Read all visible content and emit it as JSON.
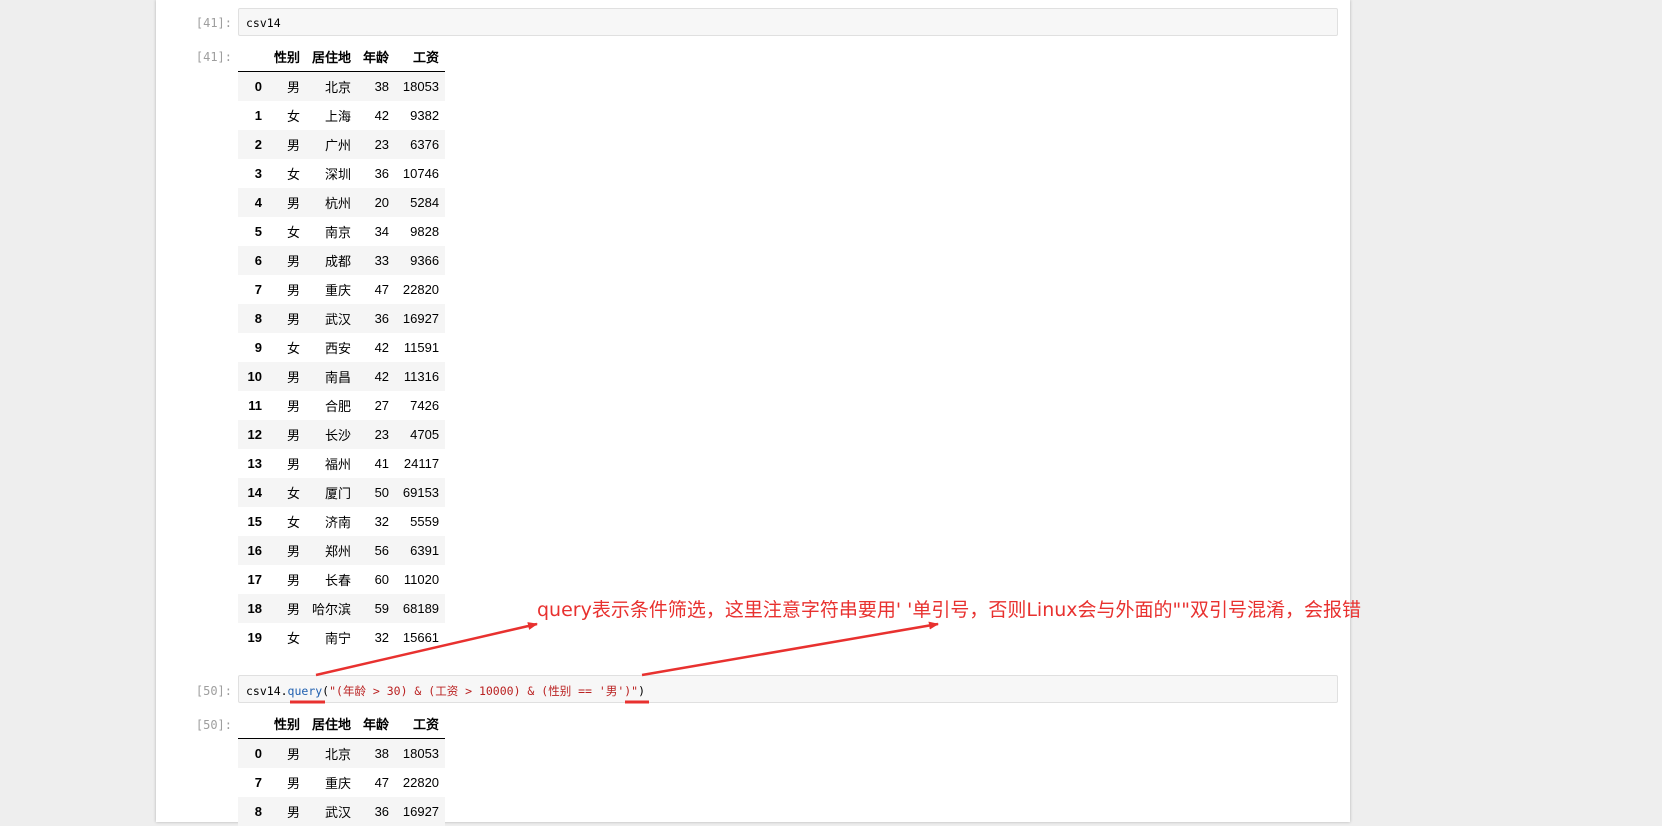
{
  "cells": [
    {
      "prompt_in": "[41]:",
      "code": "csv14",
      "prompt_out": "[41]:",
      "table": {
        "columns": [
          "性别",
          "居住地",
          "年龄",
          "工资"
        ],
        "rows": [
          {
            "index": "0",
            "性别": "男",
            "居住地": "北京",
            "年龄": "38",
            "工资": "18053"
          },
          {
            "index": "1",
            "性别": "女",
            "居住地": "上海",
            "年龄": "42",
            "工资": "9382"
          },
          {
            "index": "2",
            "性别": "男",
            "居住地": "广州",
            "年龄": "23",
            "工资": "6376"
          },
          {
            "index": "3",
            "性别": "女",
            "居住地": "深圳",
            "年龄": "36",
            "工资": "10746"
          },
          {
            "index": "4",
            "性别": "男",
            "居住地": "杭州",
            "年龄": "20",
            "工资": "5284"
          },
          {
            "index": "5",
            "性别": "女",
            "居住地": "南京",
            "年龄": "34",
            "工资": "9828"
          },
          {
            "index": "6",
            "性别": "男",
            "居住地": "成都",
            "年龄": "33",
            "工资": "9366"
          },
          {
            "index": "7",
            "性别": "男",
            "居住地": "重庆",
            "年龄": "47",
            "工资": "22820"
          },
          {
            "index": "8",
            "性别": "男",
            "居住地": "武汉",
            "年龄": "36",
            "工资": "16927"
          },
          {
            "index": "9",
            "性别": "女",
            "居住地": "西安",
            "年龄": "42",
            "工资": "11591"
          },
          {
            "index": "10",
            "性别": "男",
            "居住地": "南昌",
            "年龄": "42",
            "工资": "11316"
          },
          {
            "index": "11",
            "性别": "男",
            "居住地": "合肥",
            "年龄": "27",
            "工资": "7426"
          },
          {
            "index": "12",
            "性别": "男",
            "居住地": "长沙",
            "年龄": "23",
            "工资": "4705"
          },
          {
            "index": "13",
            "性别": "男",
            "居住地": "福州",
            "年龄": "41",
            "工资": "24117"
          },
          {
            "index": "14",
            "性别": "女",
            "居住地": "厦门",
            "年龄": "50",
            "工资": "69153"
          },
          {
            "index": "15",
            "性别": "女",
            "居住地": "济南",
            "年龄": "32",
            "工资": "5559"
          },
          {
            "index": "16",
            "性别": "男",
            "居住地": "郑州",
            "年龄": "56",
            "工资": "6391"
          },
          {
            "index": "17",
            "性别": "男",
            "居住地": "长春",
            "年龄": "60",
            "工资": "11020"
          },
          {
            "index": "18",
            "性别": "男",
            "居住地": "哈尔滨",
            "年龄": "59",
            "工资": "68189"
          },
          {
            "index": "19",
            "性别": "女",
            "居住地": "南宁",
            "年龄": "32",
            "工资": "15661"
          }
        ]
      }
    },
    {
      "prompt_in": "[50]:",
      "code_parts": {
        "var": "csv14.",
        "method": "query",
        "open": "(",
        "str_a": "\"(年龄 > 30) & (工资 > 10000) & (性别 == '",
        "str_b": "男",
        "str_c": "')\"",
        "close": ")"
      },
      "prompt_out": "[50]:",
      "table": {
        "columns": [
          "性别",
          "居住地",
          "年龄",
          "工资"
        ],
        "rows": [
          {
            "index": "0",
            "性别": "男",
            "居住地": "北京",
            "年龄": "38",
            "工资": "18053"
          },
          {
            "index": "7",
            "性别": "男",
            "居住地": "重庆",
            "年龄": "47",
            "工资": "22820"
          },
          {
            "index": "8",
            "性别": "男",
            "居住地": "武汉",
            "年龄": "36",
            "工资": "16927"
          }
        ]
      }
    }
  ],
  "annotation": {
    "text": "query表示条件筛选，这里注意字符串要用' '单引号，否则Linux会与外面的\"\"双引号混淆，会报错",
    "color": "#e8312f"
  },
  "colors": {
    "page_bg": "#eeeeee",
    "notebook_bg": "#ffffff",
    "prompt": "#9e9e9e",
    "code_method": "#2060b0",
    "code_string": "#ba2121"
  }
}
